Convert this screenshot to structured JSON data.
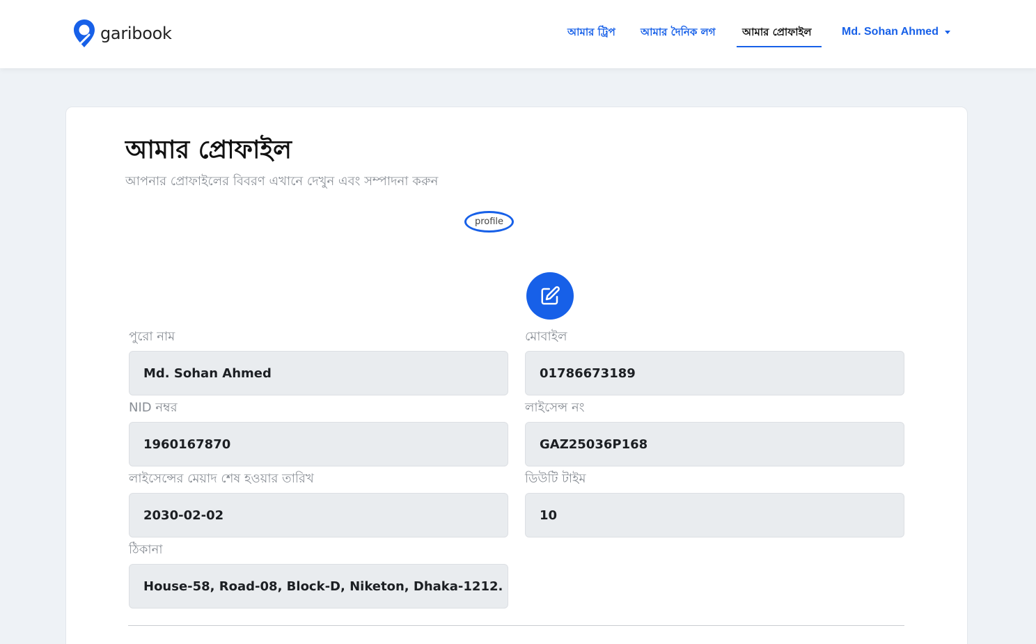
{
  "header": {
    "logo_text": "garibook",
    "nav": [
      {
        "label": "আমার ট্রিপ",
        "active": false
      },
      {
        "label": "আমার দৈনিক লগ",
        "active": false
      },
      {
        "label": "আমার প্রোফাইল",
        "active": true
      }
    ],
    "user_name": "Md. Sohan Ahmed",
    "user_menu_icon": "caret-down-icon"
  },
  "profile": {
    "title": "আমার প্রোফাইল",
    "subtitle": "আপনার প্রোফাইলের বিবরণ এখানে দেখুন এবং সম্পাদনা করুন",
    "avatar_alt": "profile",
    "edit_icon": "edit-icon",
    "fields": {
      "full_name": {
        "label": "পুরো নাম",
        "value": "Md. Sohan Ahmed"
      },
      "mobile": {
        "label": "মোবাইল",
        "value": "01786673189"
      },
      "nid": {
        "label": "NID নম্বর",
        "value": "1960167870"
      },
      "license": {
        "label": "লাইসেন্স নং",
        "value": "GAZ25036P168"
      },
      "license_expiry": {
        "label": "লাইসেন্সের মেয়াদ শেষ হওয়ার তারিখ",
        "value": "2030-02-02"
      },
      "duty_time": {
        "label": "ডিউটি টাইম",
        "value": "10"
      },
      "address": {
        "label": "ঠিকানা",
        "value": "House-58, Road-08, Block-D, Niketon, Dhaka-1212."
      }
    }
  },
  "colors": {
    "accent": "#1760e8",
    "background": "#eef2f6",
    "field_bg": "#e9ecef",
    "muted_text": "#8a8f96"
  }
}
